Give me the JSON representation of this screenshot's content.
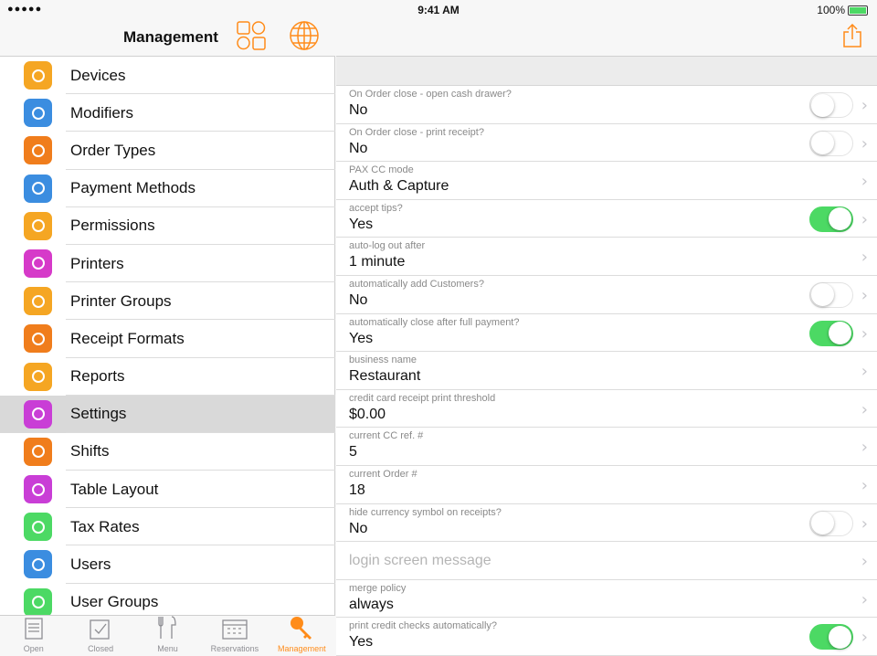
{
  "status": {
    "signal": "●●●●●",
    "time": "9:41 AM",
    "battery": "100%"
  },
  "sidebar": {
    "title": "Management",
    "items": [
      {
        "label": "Devices",
        "color": "#f5a623",
        "icon": "devices-icon"
      },
      {
        "label": "Modifiers",
        "color": "#3b8de0",
        "icon": "modifiers-icon"
      },
      {
        "label": "Order Types",
        "color": "#f07d1c",
        "icon": "order-types-icon"
      },
      {
        "label": "Payment Methods",
        "color": "#3b8de0",
        "icon": "payment-methods-icon"
      },
      {
        "label": "Permissions",
        "color": "#f5a623",
        "icon": "permissions-icon"
      },
      {
        "label": "Printers",
        "color": "#d63ac9",
        "icon": "printer-icon"
      },
      {
        "label": "Printer Groups",
        "color": "#f5a623",
        "icon": "printer-groups-icon"
      },
      {
        "label": "Receipt Formats",
        "color": "#f07d1c",
        "icon": "receipt-formats-icon"
      },
      {
        "label": "Reports",
        "color": "#f5a623",
        "icon": "reports-icon"
      },
      {
        "label": "Settings",
        "color": "#c93ed6",
        "icon": "settings-icon"
      },
      {
        "label": "Shifts",
        "color": "#f07d1c",
        "icon": "shifts-icon"
      },
      {
        "label": "Table Layout",
        "color": "#c93ed6",
        "icon": "table-layout-icon"
      },
      {
        "label": "Tax Rates",
        "color": "#4cd964",
        "icon": "tax-rates-icon"
      },
      {
        "label": "Users",
        "color": "#3b8de0",
        "icon": "users-icon"
      },
      {
        "label": "User Groups",
        "color": "#4cd964",
        "icon": "user-groups-icon"
      }
    ],
    "selected_index": 9
  },
  "tabs": [
    {
      "label": "Open",
      "active": false
    },
    {
      "label": "Closed",
      "active": false
    },
    {
      "label": "Menu",
      "active": false
    },
    {
      "label": "Reservations",
      "active": false
    },
    {
      "label": "Management",
      "active": true
    }
  ],
  "settings": [
    {
      "caption": "On Order close - open cash drawer?",
      "value": "No",
      "toggle": "off"
    },
    {
      "caption": "On Order close - print receipt?",
      "value": "No",
      "toggle": "off"
    },
    {
      "caption": "PAX CC mode",
      "value": "Auth & Capture",
      "toggle": "none"
    },
    {
      "caption": "accept tips?",
      "value": "Yes",
      "toggle": "on"
    },
    {
      "caption": "auto-log out after",
      "value": "1 minute",
      "toggle": "none"
    },
    {
      "caption": "automatically add Customers?",
      "value": "No",
      "toggle": "off"
    },
    {
      "caption": "automatically close after full payment?",
      "value": "Yes",
      "toggle": "on"
    },
    {
      "caption": "business name",
      "value": "Restaurant",
      "toggle": "none"
    },
    {
      "caption": "credit card receipt print threshold",
      "value": "$0.00",
      "toggle": "none"
    },
    {
      "caption": "current CC ref. #",
      "value": "5",
      "toggle": "none"
    },
    {
      "caption": "current Order #",
      "value": "18",
      "toggle": "none"
    },
    {
      "caption": "hide currency symbol on receipts?",
      "value": "No",
      "toggle": "off"
    },
    {
      "caption": "",
      "value": "",
      "placeholder": "login screen message",
      "toggle": "none"
    },
    {
      "caption": "merge policy",
      "value": "always",
      "toggle": "none"
    },
    {
      "caption": "print credit checks automatically?",
      "value": "Yes",
      "toggle": "on"
    }
  ],
  "colors": {
    "accent": "#ff8c1a",
    "toggle_on": "#4cd964"
  }
}
